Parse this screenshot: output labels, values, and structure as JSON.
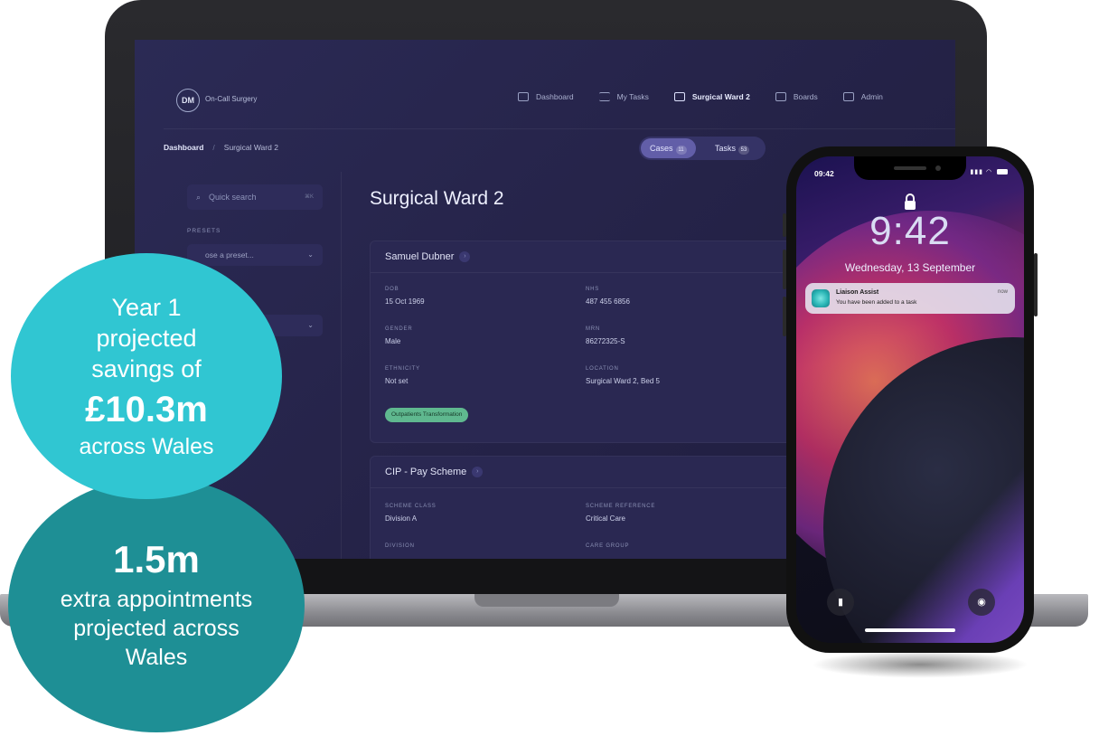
{
  "laptop_app": {
    "logo_initials": "DM",
    "brand": "On-Call Surgery",
    "nav": [
      {
        "label": "Dashboard",
        "icon": "dashboard-icon"
      },
      {
        "label": "My Tasks",
        "icon": "tasks-list-icon"
      },
      {
        "label": "Surgical Ward 2",
        "icon": "ward-icon"
      },
      {
        "label": "Boards",
        "icon": "boards-icon"
      },
      {
        "label": "Admin",
        "icon": "admin-icon"
      }
    ],
    "breadcrumb": {
      "root": "Dashboard",
      "separator": "/",
      "current": "Surgical Ward 2"
    },
    "toggle": {
      "cases_label": "Cases",
      "cases_count": "11",
      "tasks_label": "Tasks",
      "tasks_count": "53"
    },
    "sidebar": {
      "search_placeholder": "Quick search",
      "search_shortcut": "⌘K",
      "presets_label": "PRESETS",
      "preset_placeholder": "ose a preset..."
    },
    "page_title": "Surgical Ward 2",
    "patient_card": {
      "name": "Samuel Dubner",
      "fields": [
        {
          "label": "DOB",
          "value": "15 Oct 1969"
        },
        {
          "label": "NHS",
          "value": "487 455 6856"
        },
        {
          "label": "GENDER",
          "value": "Male"
        },
        {
          "label": "MRN",
          "value": "86272325-S"
        },
        {
          "label": "ETHNICITY",
          "value": "Not set"
        },
        {
          "label": "LOCATION",
          "value": "Surgical Ward 2, Bed 5"
        }
      ],
      "tag": "Outpatients Transformation"
    },
    "scheme_card": {
      "name": "CIP - Pay Scheme",
      "fields": [
        {
          "label": "SCHEME CLASS",
          "value": "Division A"
        },
        {
          "label": "SCHEME REFERENCE",
          "value": "Critical Care"
        },
        {
          "label": "DIVISION",
          "value": ""
        },
        {
          "label": "CARE GROUP",
          "value": ""
        }
      ]
    }
  },
  "phone": {
    "status_time": "09:42",
    "lock_time": "9:42",
    "lock_date": "Wednesday, 13 September",
    "notification": {
      "app": "Liaison Assist",
      "body": "You have been added to a task",
      "time": "now"
    }
  },
  "callouts": {
    "first": {
      "line1": "Year 1",
      "line2": "projected",
      "line3": "savings of",
      "figure": "£10.3m",
      "line4": "across Wales"
    },
    "second": {
      "figure": "1.5m",
      "line1": "extra appointments",
      "line2": "projected across",
      "line3": "Wales"
    }
  },
  "colors": {
    "callout_light": "#30c6d2",
    "callout_dark": "#1e8f95",
    "app_background": "#26244a",
    "tag_green": "#5fb88f"
  }
}
